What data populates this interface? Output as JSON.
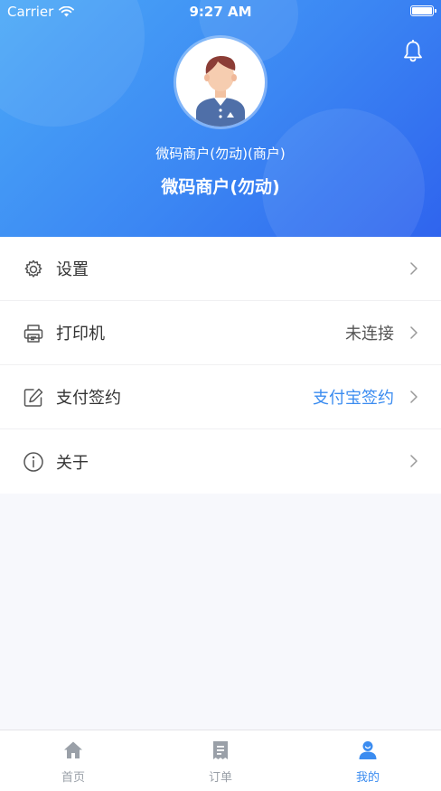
{
  "status_bar": {
    "carrier": "Carrier",
    "time": "9:27 AM"
  },
  "profile": {
    "subtitle": "微码商户(勿动)(商户)",
    "name": "微码商户(勿动)"
  },
  "menu": {
    "items": [
      {
        "label": "设置",
        "value": "",
        "icon": "gear-icon"
      },
      {
        "label": "打印机",
        "value": "未连接",
        "icon": "printer-icon"
      },
      {
        "label": "支付签约",
        "value": "支付宝签约",
        "icon": "edit-icon"
      },
      {
        "label": "关于",
        "value": "",
        "icon": "info-icon"
      }
    ]
  },
  "tabbar": {
    "tabs": [
      {
        "label": "首页",
        "icon": "home-icon",
        "active": false
      },
      {
        "label": "订单",
        "icon": "order-icon",
        "active": false
      },
      {
        "label": "我的",
        "icon": "profile-icon",
        "active": true
      }
    ]
  },
  "colors": {
    "accent": "#3b8cf0",
    "header_start": "#4aa8f7",
    "header_end": "#2f64ee"
  }
}
